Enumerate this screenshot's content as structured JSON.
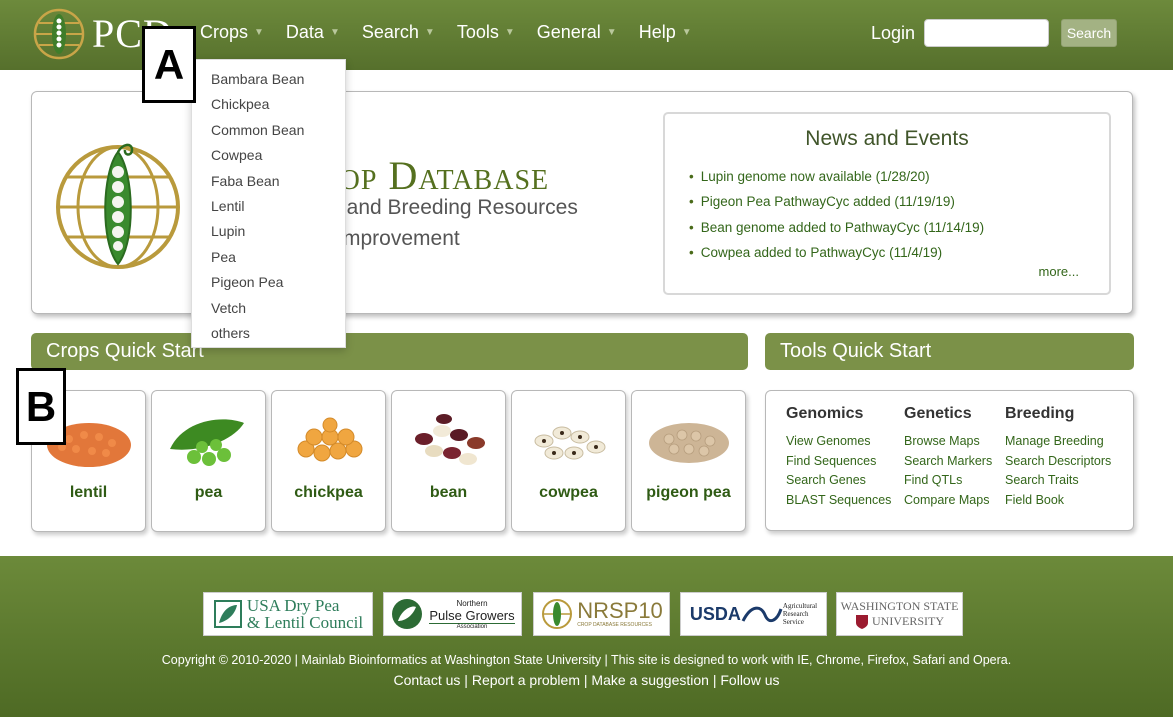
{
  "header": {
    "logo_text": "PCD",
    "nav": [
      {
        "label": "Crops"
      },
      {
        "label": "Data"
      },
      {
        "label": "Search"
      },
      {
        "label": "Tools"
      },
      {
        "label": "General"
      },
      {
        "label": "Help"
      }
    ],
    "login_label": "Login",
    "search_button_label": "Search",
    "search_value": ""
  },
  "callouts": {
    "a": "A",
    "b": "B"
  },
  "crops_menu": [
    "Bambara Bean",
    "Chickpea",
    "Common Bean",
    "Cowpea",
    "Faba Bean",
    "Lentil",
    "Lupin",
    "Pea",
    "Pigeon Pea",
    "Vetch",
    "others"
  ],
  "banner": {
    "title": "rop Database",
    "subtitle_line1": "tic, and Breeding Resources",
    "subtitle_line2": "mprovement"
  },
  "news": {
    "title": "News and Events",
    "items": [
      "Lupin genome now available (1/28/20)",
      "Pigeon Pea PathwayCyc added (11/19/19)",
      "Bean genome added to PathwayCyc (11/14/19)",
      "Cowpea added to PathwayCyc (11/4/19)"
    ],
    "more_label": "more..."
  },
  "crops_quick_start": {
    "title": "Crops Quick Start",
    "cards": [
      {
        "label": "lentil",
        "icon": "lentil-image"
      },
      {
        "label": "pea",
        "icon": "pea-image"
      },
      {
        "label": "chickpea",
        "icon": "chickpea-image"
      },
      {
        "label": "bean",
        "icon": "bean-image"
      },
      {
        "label": "cowpea",
        "icon": "cowpea-image"
      },
      {
        "label": "pigeon pea",
        "icon": "pigeon-pea-image"
      }
    ]
  },
  "tools_quick_start": {
    "title": "Tools Quick Start",
    "columns": [
      {
        "heading": "Genomics",
        "links": [
          "View Genomes",
          "Find Sequences",
          "Search Genes",
          "BLAST Sequences"
        ]
      },
      {
        "heading": "Genetics",
        "links": [
          "Browse Maps",
          "Search Markers",
          "Find QTLs",
          "Compare Maps"
        ]
      },
      {
        "heading": "Breeding",
        "links": [
          "Manage Breeding",
          "Search Descriptors",
          "Search Traits",
          "Field Book"
        ]
      }
    ]
  },
  "footer": {
    "sponsors": {
      "usa_dry_pea_line1": "USA Dry Pea",
      "usa_dry_pea_line2": "& Lentil Council",
      "npga_line1": "Northern",
      "npga_line2": "Pulse Growers",
      "npga_line3": "Association",
      "nrsp10": "NRSP10",
      "nrsp10_sub": "CROP DATABASE RESOURCES",
      "usda": "USDA",
      "ars_line1": "Agricultural",
      "ars_line2": "Research",
      "ars_line3": "Service",
      "wsu_line1": "WASHINGTON STATE",
      "wsu_line2": "UNIVERSITY"
    },
    "copyright": "Copyright © 2010-2020 | Mainlab Bioinformatics at Washington State University | This site is designed to work with IE, Chrome, Firefox, Safari and Opera.",
    "links": [
      "Contact us",
      "Report a problem",
      "Make a suggestion",
      "Follow us"
    ]
  },
  "colors": {
    "header_green": "#5f7b33",
    "link_green": "#33661a",
    "bar_green": "#7b9148"
  }
}
